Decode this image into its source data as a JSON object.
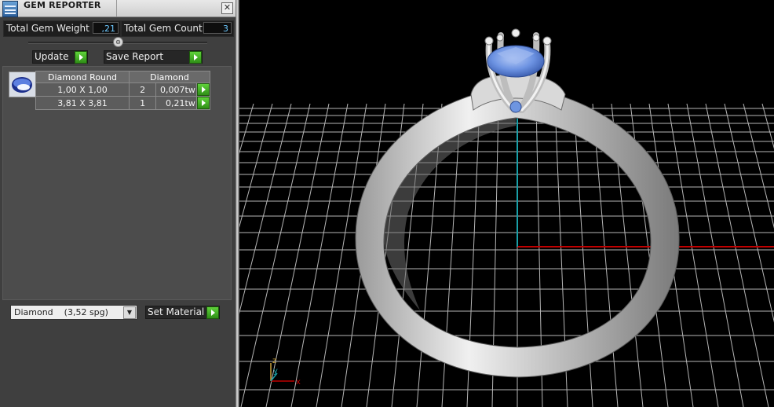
{
  "panel": {
    "title": "GEM REPORTER",
    "close_label": "✕",
    "stats": {
      "weight_label": "Total Gem Weight",
      "weight_value": ",21",
      "count_label": "Total Gem Count",
      "count_value": "3"
    },
    "collapse_glyph": "⊖",
    "buttons": {
      "update": "Update",
      "save_report": "Save Report",
      "set_material": "Set Material"
    },
    "table": {
      "headers": [
        "Diamond Round",
        "Diamond"
      ],
      "rows": [
        {
          "size": "1,00 X 1,00",
          "count": "2",
          "weight": "0,007tw"
        },
        {
          "size": "3,81 X 3,81",
          "count": "1",
          "weight": "0,21tw"
        }
      ]
    },
    "material": {
      "name": "Diamond",
      "density": "(3,52 spg)",
      "dropdown_glyph": "▼"
    }
  },
  "viewport": {
    "axis_labels": {
      "z": "z",
      "y": "y",
      "x": "x"
    },
    "colors": {
      "background": "#000000",
      "grid": "#d9d9d9",
      "x_axis": "#c00000",
      "y_axis": "#19a0a8",
      "gem": "#6e95e0",
      "metal": "#cfcfcf"
    }
  }
}
